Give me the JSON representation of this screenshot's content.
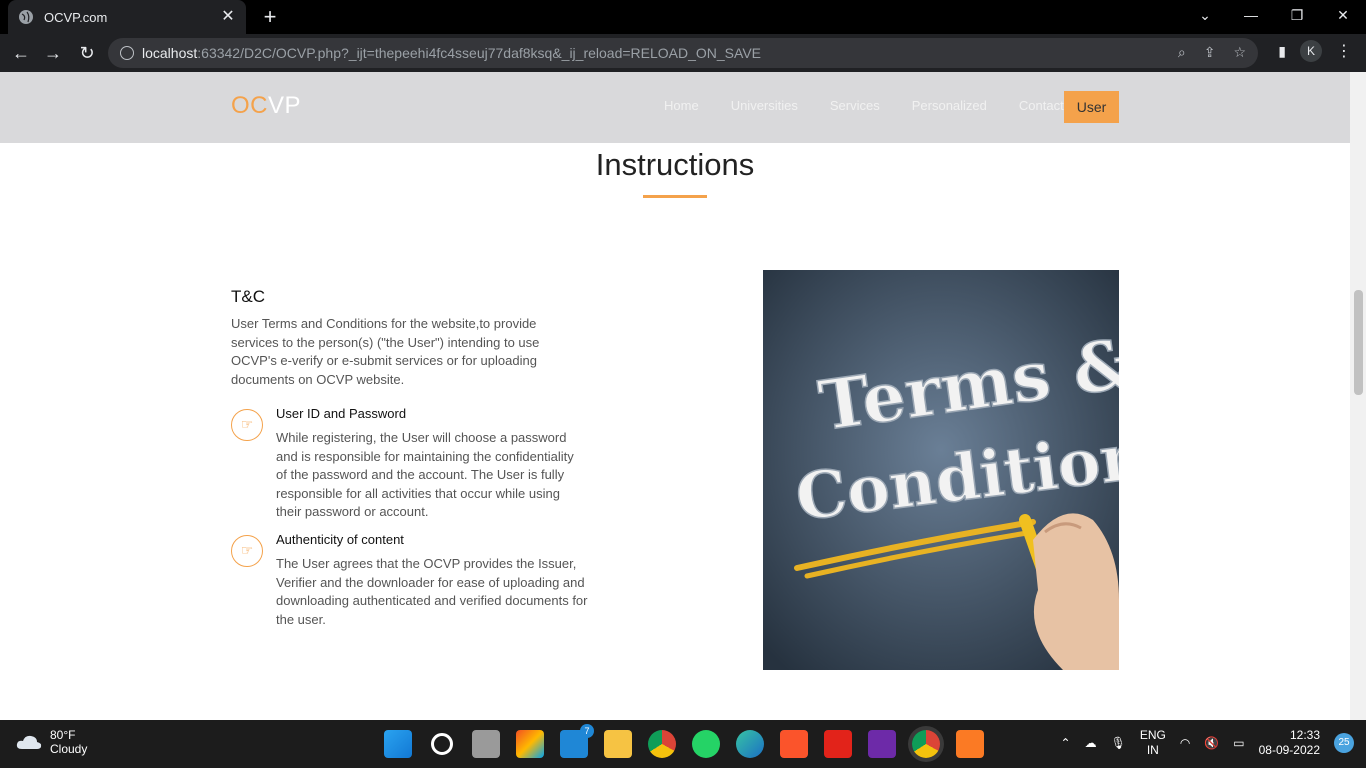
{
  "browser": {
    "tab_title": "OCVP.com",
    "new_tab_symbol": "+",
    "tab_close_symbol": "✕",
    "url_host": "localhost",
    "url_rest": ":63342/D2C/OCVP.php?_ijt=thepeehi4fc4sseuj77daf8ksq&_ij_reload=RELOAD_ON_SAVE",
    "profile_initial": "K"
  },
  "site": {
    "logo_oc": "OC",
    "logo_vp": "VP",
    "nav": [
      "Home",
      "Universities",
      "Services",
      "Personalized",
      "Contact"
    ],
    "user_button": "User"
  },
  "section": {
    "title": "Instructions",
    "tc_heading": "T&C",
    "tc_intro": "User Terms and Conditions for the website,to provide services to the person(s) (\"the User\") intending to use OCVP's e-verify or e-submit services or for uploading documents on OCVP website.",
    "items": [
      {
        "title": "User ID and Password",
        "text": "While registering, the User will choose a password and is responsible for maintaining the confidentiality of the password and the account. The User is fully responsible for all activities that occur while using their password or account."
      },
      {
        "title": "Authenticity of content",
        "text": "The User agrees that the OCVP provides the Issuer, Verifier and the downloader for ease of uploading and downloading authenticated and verified documents for the user."
      }
    ],
    "image_text_1": "Terms &",
    "image_text_2": "Conditions"
  },
  "taskbar": {
    "temperature": "80°F",
    "condition": "Cloudy",
    "mail_badge": "7",
    "lang_1": "ENG",
    "lang_2": "IN",
    "time": "12:33",
    "date": "08-09-2022",
    "notification_count": "25"
  },
  "colors": {
    "accent": "#f4a24b",
    "header_bg": "#d9d9db"
  }
}
